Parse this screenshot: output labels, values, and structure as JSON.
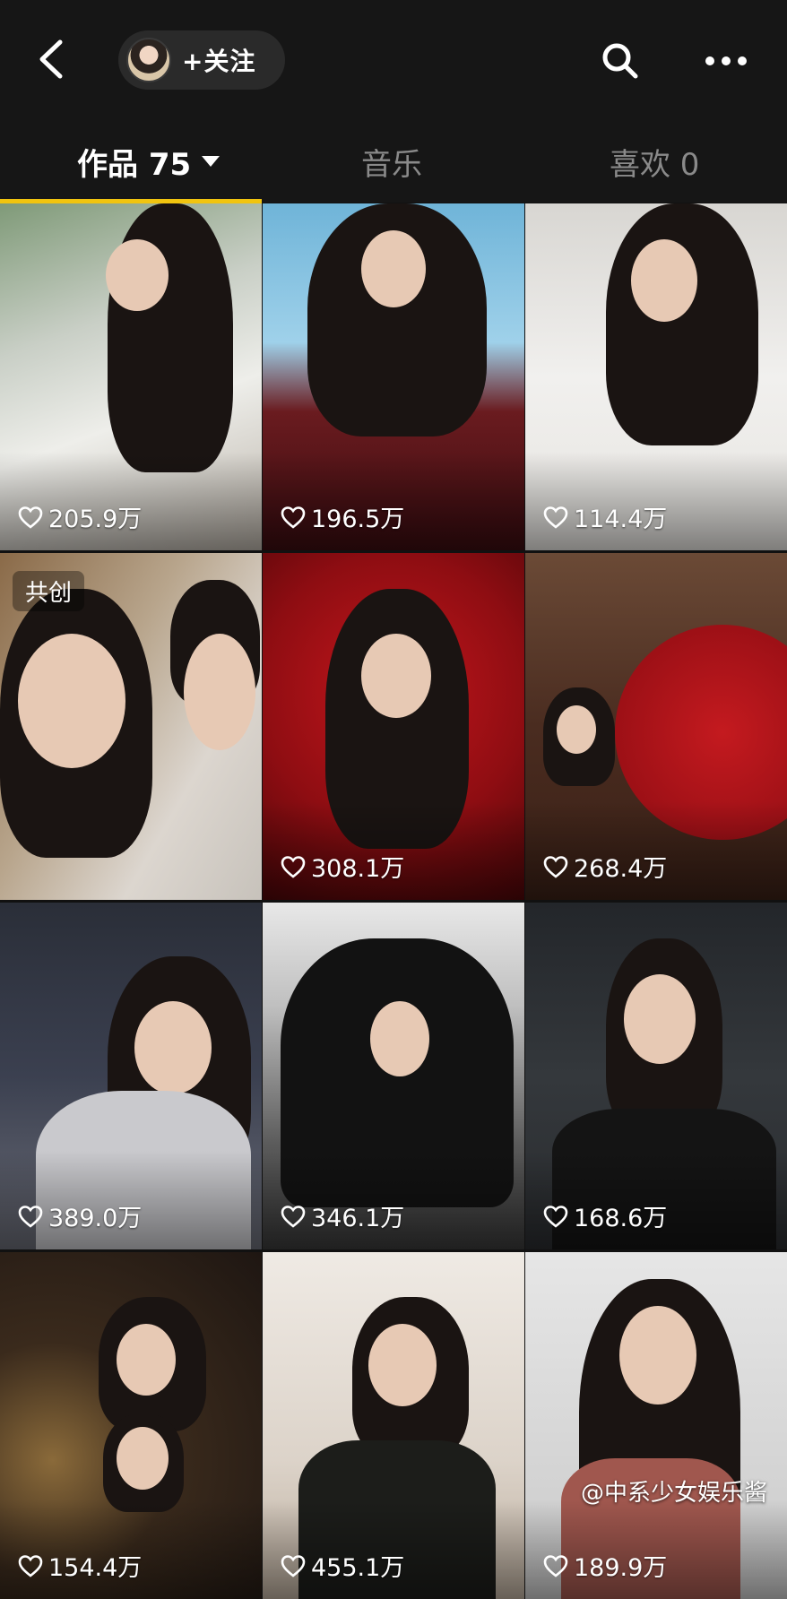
{
  "header": {
    "follow_label": "+关注"
  },
  "tabs": {
    "works": "作品 75",
    "music": "音乐",
    "likes": "喜欢 0"
  },
  "grid": {
    "items": [
      {
        "likes": "205.9万",
        "badge": ""
      },
      {
        "likes": "196.5万",
        "badge": ""
      },
      {
        "likes": "114.4万",
        "badge": ""
      },
      {
        "likes": "",
        "badge": "共创"
      },
      {
        "likes": "308.1万",
        "badge": ""
      },
      {
        "likes": "268.4万",
        "badge": ""
      },
      {
        "likes": "389.0万",
        "badge": ""
      },
      {
        "likes": "346.1万",
        "badge": ""
      },
      {
        "likes": "168.6万",
        "badge": ""
      },
      {
        "likes": "154.4万",
        "badge": ""
      },
      {
        "likes": "455.1万",
        "badge": ""
      },
      {
        "likes": "189.9万",
        "badge": ""
      }
    ]
  },
  "watermark": "@中系少女娱乐酱",
  "colors": {
    "background": "#111111",
    "tab_indicator": "#f1c40f",
    "active_tab_text": "#ffffff",
    "inactive_tab_text": "#8a8a8a"
  }
}
